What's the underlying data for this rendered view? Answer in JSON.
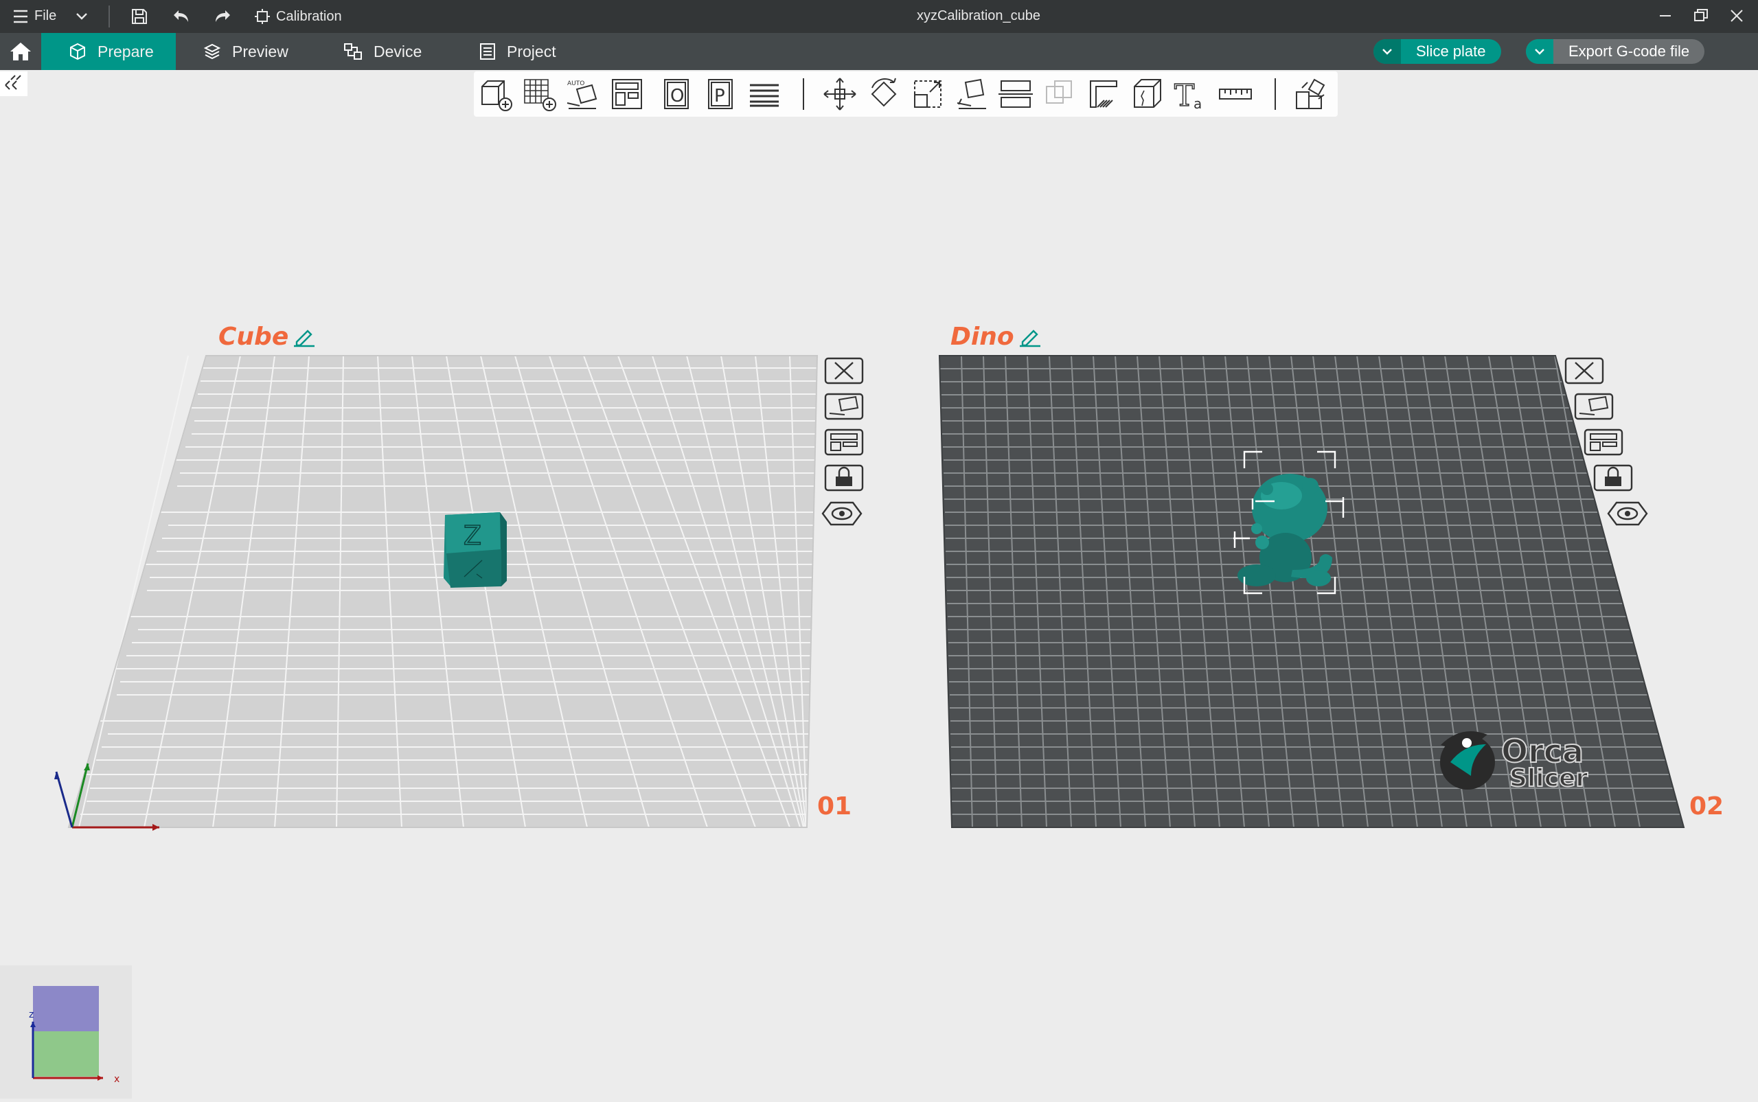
{
  "titlebar": {
    "menu_label": "File",
    "calibration_label": "Calibration",
    "window_title": "xyzCalibration_cube"
  },
  "tabs": [
    {
      "label": "Prepare"
    },
    {
      "label": "Preview"
    },
    {
      "label": "Device"
    },
    {
      "label": "Project"
    }
  ],
  "actions": {
    "slice_label": "Slice plate",
    "export_label": "Export G-code file"
  },
  "colors": {
    "accent": "#009688",
    "title_bar": "#333637",
    "nav_bar": "#44494b",
    "plate_label": "#f0693d",
    "model": "#1b8a80"
  },
  "toolbar_icons": [
    "add-object-icon",
    "add-plate-icon",
    "auto-orient-icon",
    "arrange-icon",
    "split-objects-icon",
    "split-parts-icon",
    "variable-layer-height-icon",
    "move-icon",
    "rotate-icon",
    "scale-icon",
    "lay-on-face-icon",
    "cut-icon",
    "mesh-boolean-icon",
    "support-painting-icon",
    "seam-painting-icon",
    "text-icon",
    "measure-icon",
    "assembly-view-icon"
  ],
  "plates": [
    {
      "name": "Cube",
      "number": "01",
      "model": "Z",
      "buttons": [
        "close-icon",
        "auto-orient-icon",
        "arrange-icon",
        "lock-icon",
        "eye-icon"
      ]
    },
    {
      "name": "Dino",
      "number": "02",
      "buttons": [
        "close-icon",
        "auto-orient-icon",
        "arrange-icon",
        "lock-icon",
        "eye-icon"
      ]
    }
  ],
  "logo": {
    "line1": "Orca",
    "line2": "Slicer"
  },
  "axis": {
    "z": "z",
    "x": "x"
  }
}
